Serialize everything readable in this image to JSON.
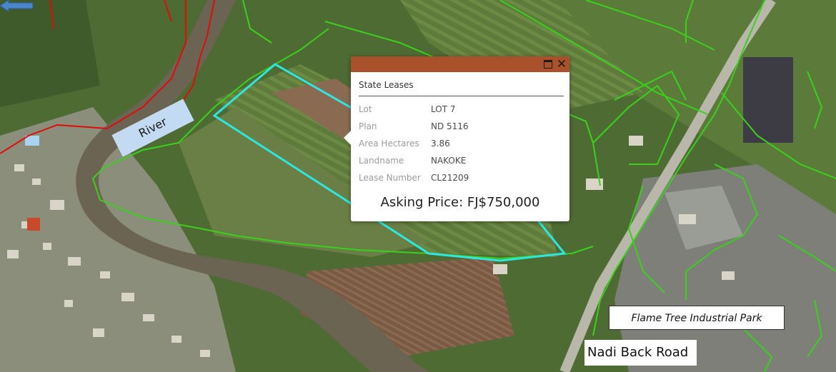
{
  "popup": {
    "title": "State Leases",
    "maximize_icon": "maximize-icon",
    "close_icon": "close-icon",
    "fields": [
      {
        "key": "Lot",
        "value": "LOT 7"
      },
      {
        "key": "Plan",
        "value": "ND 5116"
      },
      {
        "key": "Area Hectares",
        "value": "3.86"
      },
      {
        "key": "Landname",
        "value": "NAKOKE"
      },
      {
        "key": "Lease Number",
        "value": "CL21209"
      }
    ],
    "asking_price": "Asking Price: FJ$750,000",
    "header_color": "#a9512b"
  },
  "labels": {
    "river": "River",
    "industrial_park": "Flame Tree Industrial Park",
    "road": "Nadi Back Road",
    "road_arrow_icon": "arrow-left-icon"
  },
  "colors": {
    "parcel_boundary": "#39d11c",
    "selected_lease": "#2ee6e0",
    "other_boundary": "#e00c0c",
    "river_label_bg": "#c3dbf2",
    "road_arrow": "#4a86c9"
  }
}
